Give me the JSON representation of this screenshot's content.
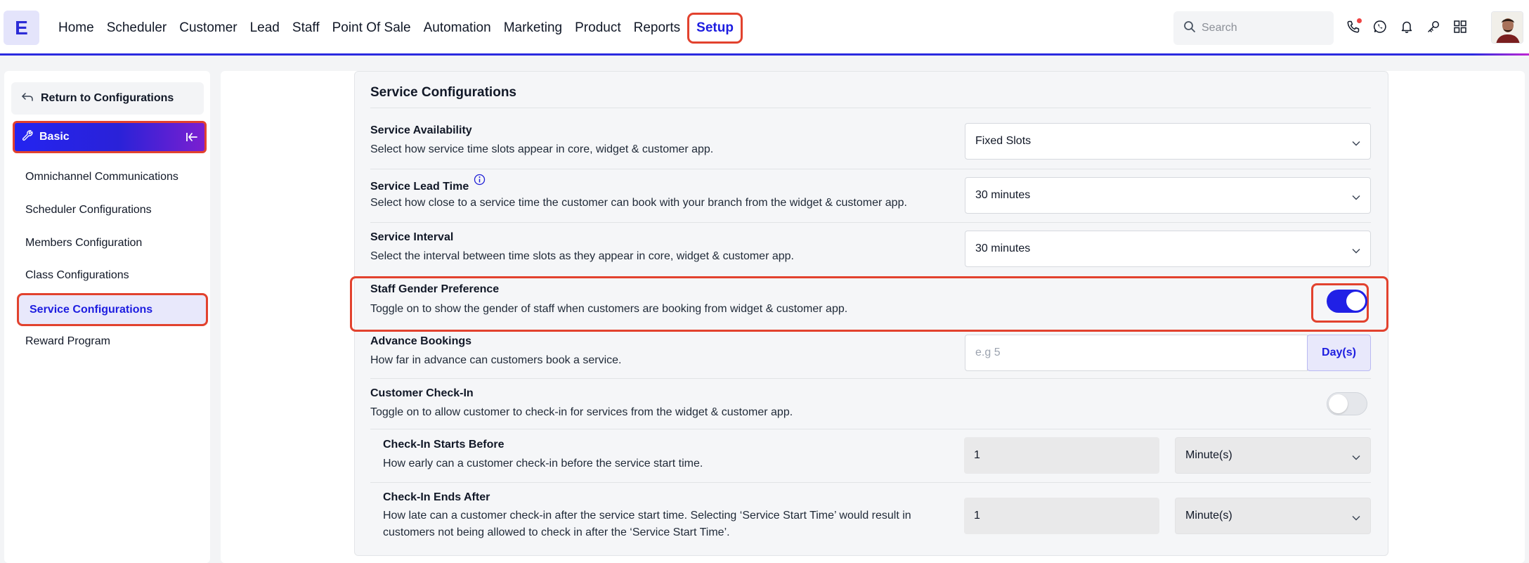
{
  "app": {
    "logo_letter": "E"
  },
  "nav": {
    "items": [
      "Home",
      "Scheduler",
      "Customer",
      "Lead",
      "Staff",
      "Point Of Sale",
      "Automation",
      "Marketing",
      "Product",
      "Reports",
      "Setup"
    ],
    "active": "Setup"
  },
  "search": {
    "placeholder": "Search"
  },
  "top_icons": [
    "phone-icon",
    "whatsapp-icon",
    "bell-icon",
    "key-icon",
    "apps-grid-icon"
  ],
  "sidebar": {
    "return_label": "Return to Configurations",
    "section_label": "Basic",
    "items": [
      {
        "label": "Omnichannel Communications"
      },
      {
        "label": "Scheduler Configurations"
      },
      {
        "label": "Members Configuration"
      },
      {
        "label": "Class Configurations"
      },
      {
        "label": "Service Configurations",
        "active": true
      },
      {
        "label": "Reward Program"
      }
    ]
  },
  "main": {
    "title": "Service Configurations",
    "availability": {
      "title": "Service Availability",
      "desc": "Select how service time slots appear in core, widget & customer app.",
      "value": "Fixed Slots"
    },
    "lead_time": {
      "title": "Service Lead Time",
      "desc": "Select how close to a service time the customer can book with your branch from the widget & customer app.",
      "value": "30 minutes"
    },
    "interval": {
      "title": "Service Interval",
      "desc": "Select the interval between time slots as they appear in core, widget & customer app.",
      "value": "30 minutes"
    },
    "gender_pref": {
      "title": "Staff Gender Preference",
      "desc": "Toggle on to show the gender of staff when customers are booking from widget & customer app.",
      "enabled": true
    },
    "advance": {
      "title": "Advance Bookings",
      "desc": "How far in advance can customers book a service.",
      "placeholder": "e.g 5",
      "unit": "Day(s)"
    },
    "checkin": {
      "title": "Customer Check-In",
      "desc": "Toggle on to allow customer to check-in for services from the widget & customer app.",
      "enabled": false
    },
    "checkin_start": {
      "title": "Check-In Starts Before",
      "desc": "How early can a customer check-in before the service start time.",
      "value": "1",
      "unit": "Minute(s)"
    },
    "checkin_end": {
      "title": "Check-In Ends After",
      "desc_line1": "How late can a customer check-in after the service start time. Selecting ‘Service Start Time’ would result in",
      "desc_line2": "customers not being allowed to check in after the ‘Service Start Time’.",
      "value": "1",
      "unit": "Minute(s)"
    }
  },
  "colors": {
    "accent": "#1d1de0",
    "highlight": "#e2422e"
  }
}
